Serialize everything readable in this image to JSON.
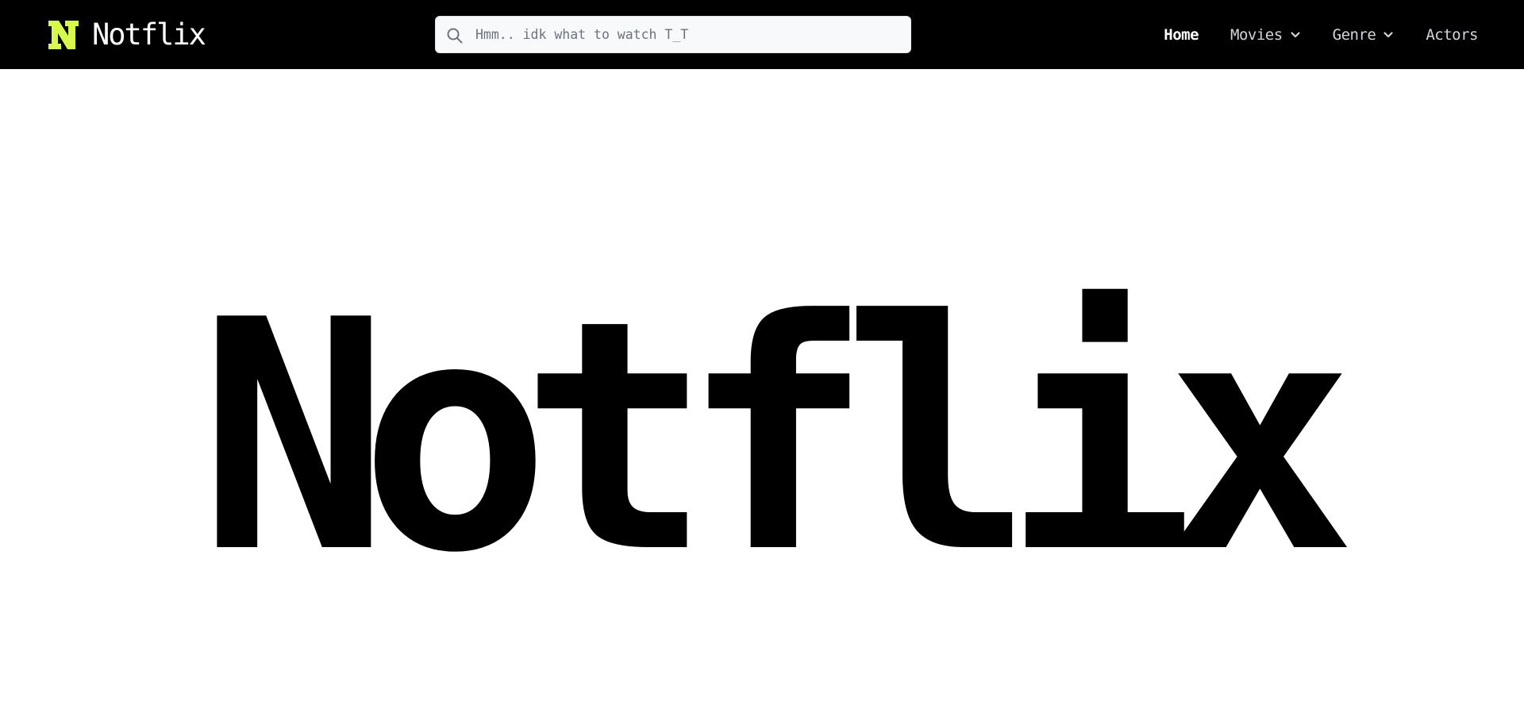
{
  "brand": {
    "name": "Notflix",
    "logo_icon": "n-logo-icon",
    "logo_color": "#d9f94a"
  },
  "search": {
    "placeholder": "Hmm.. idk what to watch T_T",
    "value": "",
    "icon": "search-icon"
  },
  "nav": {
    "items": [
      {
        "label": "Home",
        "active": true,
        "dropdown": false
      },
      {
        "label": "Movies",
        "active": false,
        "dropdown": true
      },
      {
        "label": "Genre",
        "active": false,
        "dropdown": true
      },
      {
        "label": "Actors",
        "active": false,
        "dropdown": false
      }
    ]
  },
  "hero": {
    "title": "Notflix"
  },
  "colors": {
    "navbar_bg": "#000000",
    "page_bg": "#ffffff",
    "accent": "#d9f94a"
  }
}
